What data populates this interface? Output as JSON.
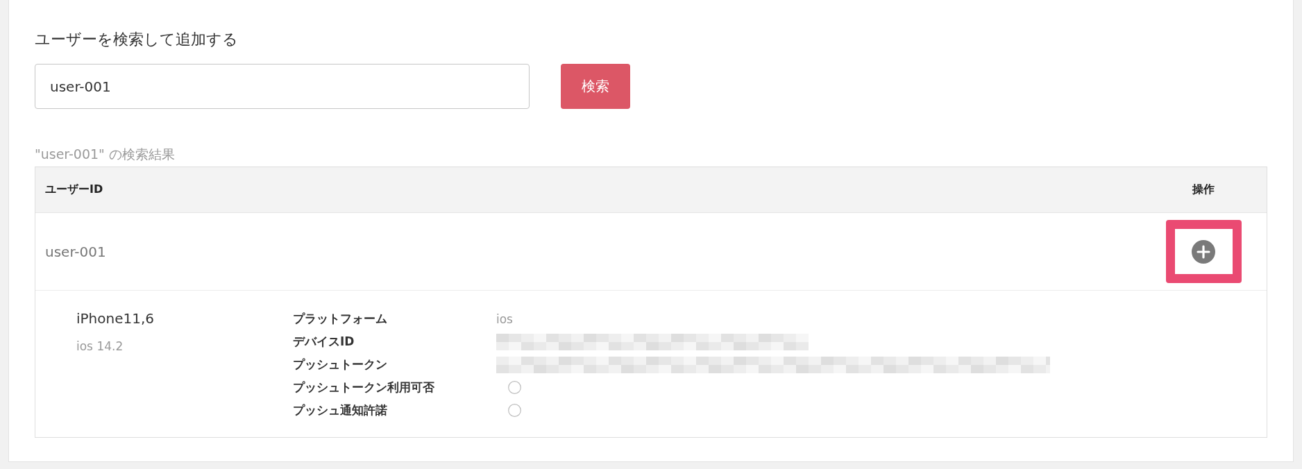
{
  "search": {
    "title": "ユーザーを検索して追加する",
    "value": "user-001",
    "button": "検索"
  },
  "results": {
    "caption": "\"user-001\" の検索結果",
    "columns": [
      "ユーザーID",
      "操作"
    ],
    "rows": [
      {
        "user_id": "user-001",
        "action": {
          "kind": "add",
          "highlighted": true
        },
        "devices": [
          {
            "model": "iPhone11,6",
            "os": "ios 14.2",
            "fields": [
              {
                "label": "プラットフォーム",
                "kind": "text",
                "value": "ios"
              },
              {
                "label": "デバイスID",
                "kind": "redacted"
              },
              {
                "label": "プッシュトークン",
                "kind": "redacted"
              },
              {
                "label": "プッシュトークン利用可否",
                "kind": "radio",
                "checked": false
              },
              {
                "label": "プッシュ通知許諾",
                "kind": "radio",
                "checked": false
              }
            ]
          }
        ]
      }
    ]
  }
}
